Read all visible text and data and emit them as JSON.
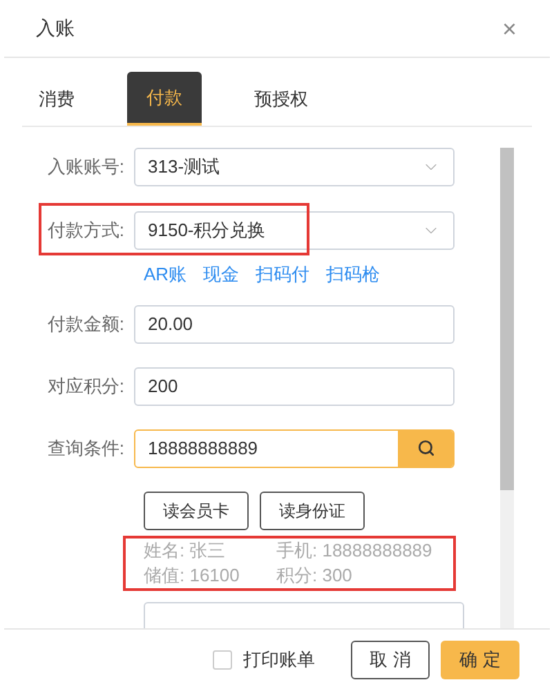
{
  "dialog": {
    "title": "入账",
    "close": "×"
  },
  "tabs": [
    {
      "label": "消费",
      "selected": false
    },
    {
      "label": "付款",
      "selected": true
    },
    {
      "label": "预授权",
      "selected": false
    }
  ],
  "form": {
    "account": {
      "label": "入账账号:",
      "value": "313-测试"
    },
    "payment_method": {
      "label": "付款方式:",
      "value": "9150-积分兑换",
      "highlighted": true
    },
    "quick_links": [
      "AR账",
      "现金",
      "扫码付",
      "扫码枪"
    ],
    "amount": {
      "label": "付款金额:",
      "value": "20.00"
    },
    "points": {
      "label": "对应积分:",
      "value": "200"
    },
    "query": {
      "label": "查询条件:",
      "value": "18888888889"
    },
    "read_buttons": [
      "读会员卡",
      "读身份证"
    ],
    "member_info": {
      "highlighted": true,
      "items": [
        "姓名: 张三",
        "手机: 18888888889",
        "储值: 16100",
        "积分: 300"
      ]
    }
  },
  "footer": {
    "print_bill": {
      "label": "打印账单",
      "checked": false
    },
    "cancel": "取 消",
    "confirm": "确 定"
  }
}
